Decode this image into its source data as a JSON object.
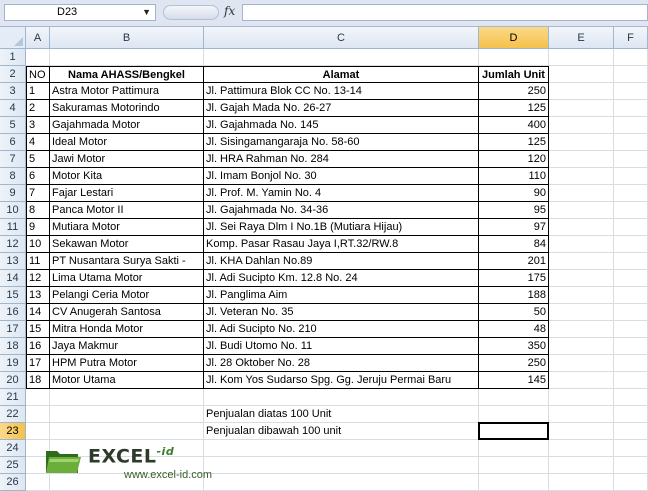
{
  "formula_bar": {
    "name_box": "D23",
    "formula": ""
  },
  "columns": [
    "A",
    "B",
    "C",
    "D",
    "E",
    "F"
  ],
  "selected_column": "D",
  "rows": [
    "1",
    "2",
    "3",
    "4",
    "5",
    "6",
    "7",
    "8",
    "9",
    "10",
    "11",
    "12",
    "13",
    "14",
    "15",
    "16",
    "17",
    "18",
    "19",
    "20",
    "21",
    "22",
    "23",
    "24",
    "25",
    "26"
  ],
  "selected_row": "23",
  "table": {
    "headers": [
      "NO",
      "Nama AHASS/Bengkel",
      "Alamat",
      "Jumlah Unit"
    ],
    "records": [
      [
        "1",
        "Astra Motor Pattimura",
        "Jl. Pattimura Blok CC No. 13-14",
        "250"
      ],
      [
        "2",
        "Sakuramas Motorindo",
        "Jl. Gajah Mada No. 26-27",
        "125"
      ],
      [
        "3",
        "Gajahmada Motor",
        "Jl. Gajahmada No. 145",
        "400"
      ],
      [
        "4",
        "Ideal Motor",
        "Jl. Sisingamangaraja No. 58-60",
        "125"
      ],
      [
        "5",
        "Jawi Motor",
        "Jl. HRA Rahman No. 284",
        "120"
      ],
      [
        "6",
        "Motor Kita",
        "Jl. Imam Bonjol No. 30",
        "110"
      ],
      [
        "7",
        "Fajar Lestari",
        "Jl. Prof. M. Yamin No. 4",
        "90"
      ],
      [
        "8",
        "Panca Motor II",
        "Jl. Gajahmada No. 34-36",
        "95"
      ],
      [
        "9",
        "Mutiara Motor",
        "Jl. Sei Raya Dlm I No.1B (Mutiara Hijau)",
        "97"
      ],
      [
        "10",
        "Sekawan Motor",
        "Komp. Pasar Rasau Jaya I,RT.32/RW.8",
        "84"
      ],
      [
        "11",
        "PT Nusantara Surya Sakti -",
        "Jl. KHA Dahlan No.89",
        "201"
      ],
      [
        "12",
        "Lima Utama Motor",
        "Jl. Adi Sucipto Km. 12.8 No. 24",
        "175"
      ],
      [
        "13",
        "Pelangi Ceria Motor",
        "Jl. Panglima Aim",
        "188"
      ],
      [
        "14",
        "CV Anugerah Santosa",
        "Jl. Veteran No. 35",
        "50"
      ],
      [
        "15",
        "Mitra Honda Motor",
        "Jl. Adi Sucipto No. 210",
        "48"
      ],
      [
        "16",
        "Jaya Makmur",
        "Jl. Budi Utomo No. 11",
        "350"
      ],
      [
        "17",
        "HPM Putra Motor",
        "Jl. 28 Oktober No. 28",
        "250"
      ],
      [
        "18",
        "Motor Utama",
        "Jl. Kom Yos Sudarso Spg. Gg. Jeruju Permai Baru",
        "145"
      ]
    ]
  },
  "summary": {
    "above_label": "Penjualan diatas 100 Unit",
    "below_label": "Penjualan dibawah 100 unit"
  },
  "watermark": {
    "brand": "EXCEL",
    "suffix": "-id",
    "url": "www.excel-id.com"
  }
}
